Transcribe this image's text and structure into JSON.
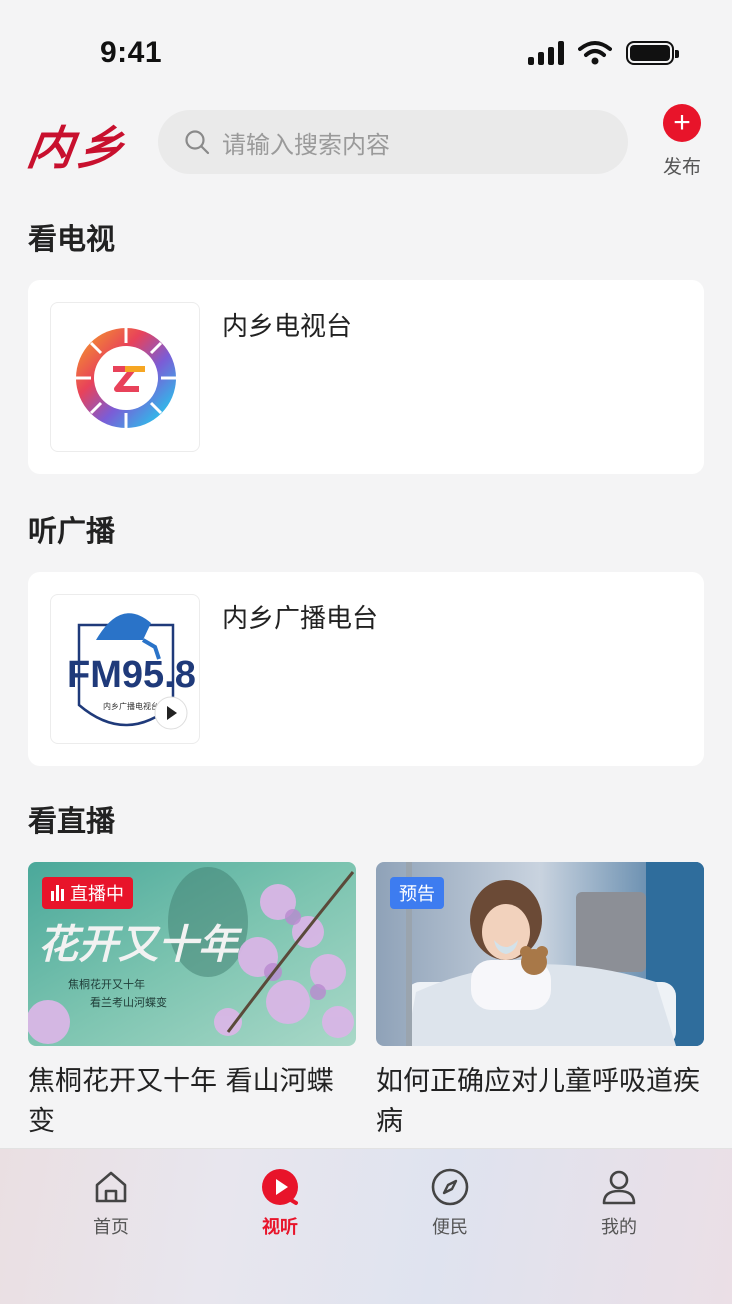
{
  "status": {
    "time": "9:41"
  },
  "header": {
    "logo_text": "内乡",
    "search_placeholder": "请输入搜索内容",
    "publish_label": "发布"
  },
  "sections": {
    "tv_title": "看电视",
    "radio_title": "听广播",
    "live_title": "看直播"
  },
  "tv": {
    "name": "内乡电视台"
  },
  "radio": {
    "name": "内乡广播电台",
    "logo_text": "FM95.8",
    "logo_sub": "内乡广播电视台"
  },
  "live": [
    {
      "badge": "直播中",
      "title": "焦桐花开又十年 看山河蝶变",
      "art_title": "花开又十年",
      "art_sub1": "焦桐花开又十年",
      "art_sub2": "看兰考山河蝶变"
    },
    {
      "badge": "预告",
      "title": "如何正确应对儿童呼吸道疾病"
    }
  ],
  "tabs": [
    {
      "label": "首页",
      "icon": "home-icon"
    },
    {
      "label": "视听",
      "icon": "play-icon"
    },
    {
      "label": "便民",
      "icon": "compass-icon"
    },
    {
      "label": "我的",
      "icon": "user-icon"
    }
  ],
  "colors": {
    "accent": "#e8142a",
    "logo": "#c8102e",
    "preview_badge": "#3d7cf0"
  }
}
